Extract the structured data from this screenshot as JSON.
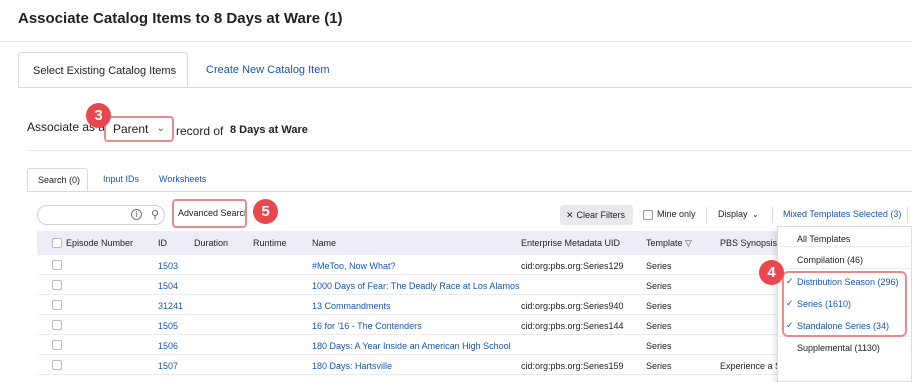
{
  "header": {
    "title": "Associate Catalog Items to 8 Days at Ware (1)"
  },
  "main_tabs": [
    {
      "label": "Select Existing Catalog Items"
    },
    {
      "label": "Create New Catalog Item"
    }
  ],
  "associate": {
    "prefix": "Associate as a",
    "selected": "Parent",
    "suffix": "record of",
    "target": "8 Days at Ware"
  },
  "badges": {
    "b3": "3",
    "b4": "4",
    "b5": "5"
  },
  "sub_tabs": [
    {
      "label": "Search (0)"
    },
    {
      "label": "Input IDs"
    },
    {
      "label": "Worksheets"
    }
  ],
  "toolbar": {
    "search_value": "",
    "advanced_search": "Advanced Search",
    "clear_filters": "Clear Filters",
    "mine_only": "Mine only",
    "display": "Display",
    "mixed_templates": "Mixed Templates Selected (3)"
  },
  "table": {
    "headers": [
      "Episode Number",
      "ID",
      "Duration",
      "Runtime",
      "Name",
      "Enterprise Metadata UID",
      "Template",
      "PBS Synopsis"
    ],
    "rows": [
      {
        "id": "1503",
        "name": "#MeToo, Now What?",
        "uid": "cid:org:pbs.org:Series129",
        "template": "Series",
        "synopsis": ""
      },
      {
        "id": "1504",
        "name": "1000 Days of Fear: The Deadly Race at Los Alamos",
        "uid": "",
        "template": "Series",
        "synopsis": ""
      },
      {
        "id": "31241",
        "name": "13 Commandments",
        "uid": "cid:org:pbs.org:Series940",
        "template": "Series",
        "synopsis": ""
      },
      {
        "id": "1505",
        "name": "16 for '16 - The Contenders",
        "uid": "cid:org:pbs.org:Series144",
        "template": "Series",
        "synopsis": ""
      },
      {
        "id": "1506",
        "name": "180 Days: A Year Inside an American High School",
        "uid": "",
        "template": "Series",
        "synopsis": ""
      },
      {
        "id": "1507",
        "name": "180 Days: Hartsville",
        "uid": "cid:org:pbs.org:Series159",
        "template": "Series",
        "synopsis": "Experience a Southern towns efforts to addre..."
      }
    ]
  },
  "template_dropdown": {
    "items": [
      {
        "label": "All Templates",
        "checked": false
      },
      {
        "label": "Compilation (46)",
        "checked": false
      },
      {
        "label": "Distribution Season (296)",
        "checked": true
      },
      {
        "label": "Series (1610)",
        "checked": true
      },
      {
        "label": "Standalone Series (34)",
        "checked": true
      },
      {
        "label": "Supplemental (1130)",
        "checked": false
      }
    ]
  },
  "colors": {
    "accent_link": "#1a55b0",
    "badge": "#e8474d",
    "highlight": "#e98a8f",
    "table_header": "#eeedf7"
  }
}
